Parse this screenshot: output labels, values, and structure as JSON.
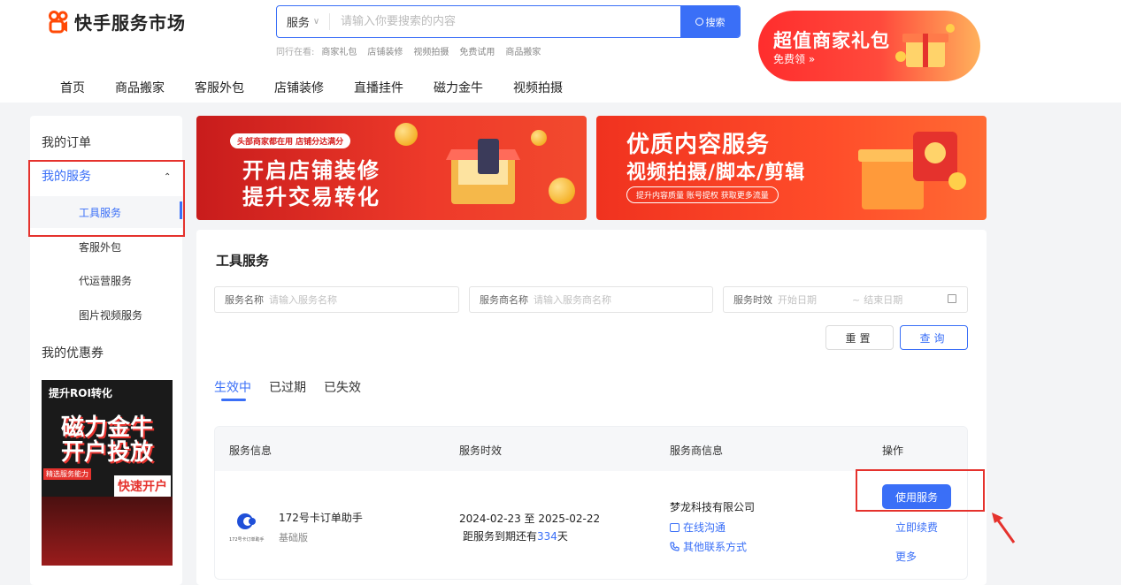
{
  "header": {
    "brand": "快手服务市场",
    "search": {
      "type": "服务",
      "placeholder": "请输入你要搜索的内容",
      "button": "搜索"
    },
    "hot": {
      "label": "同行在看:",
      "items": [
        "商家礼包",
        "店铺装修",
        "视频拍摄",
        "免费试用",
        "商品搬家"
      ]
    },
    "promo": {
      "title": "超值商家礼包",
      "sub": "免费领 »"
    },
    "nav": [
      "首页",
      "商品搬家",
      "客服外包",
      "店铺装修",
      "直播挂件",
      "磁力金牛",
      "视频拍摄"
    ]
  },
  "sidebar": {
    "my_orders": "我的订单",
    "my_services": "我的服务",
    "sub": [
      "工具服务",
      "客服外包",
      "代运营服务",
      "图片视频服务"
    ],
    "my_coupons": "我的优惠券",
    "ad": {
      "top": "提升ROI转化",
      "line1": "磁力金牛",
      "line2": "开户投放",
      "tag": "精选服务能力",
      "cta": "快速开户"
    }
  },
  "banners": {
    "b1": {
      "tag": "头部商家都在用 店铺分达满分",
      "line1": "开启店铺装修",
      "line2": "提升交易转化"
    },
    "b2": {
      "line1": "优质内容服务",
      "line2": "视频拍摄/脚本/剪辑",
      "pill": "提升内容质量 账号提权 获取更多流量"
    }
  },
  "panel": {
    "title": "工具服务",
    "filters": {
      "name_label": "服务名称",
      "name_ph": "请输入服务名称",
      "vendor_label": "服务商名称",
      "vendor_ph": "请输入服务商名称",
      "time_label": "服务时效",
      "start_ph": "开始日期",
      "sep": "~",
      "end_ph": "结束日期"
    },
    "reset": "重置",
    "query": "查询",
    "tabs": [
      "生效中",
      "已过期",
      "已失效"
    ],
    "columns": [
      "服务信息",
      "服务时效",
      "服务商信息",
      "操作"
    ],
    "rows": [
      {
        "name": "172号卡订单助手",
        "version": "基础版",
        "logo_caption": "172号卡订单助手",
        "date_range": "2024-02-23 至 2025-02-22",
        "remain_prefix": "距服务到期还有",
        "remain_days": "334",
        "remain_suffix": "天",
        "vendor": "梦龙科技有限公司",
        "chat": "在线沟通",
        "contact": "其他联系方式",
        "use": "使用服务",
        "renew": "立即续费",
        "more": "更多"
      }
    ]
  },
  "colors": {
    "accent": "#3a6ff7",
    "highlight": "#e5322d"
  }
}
